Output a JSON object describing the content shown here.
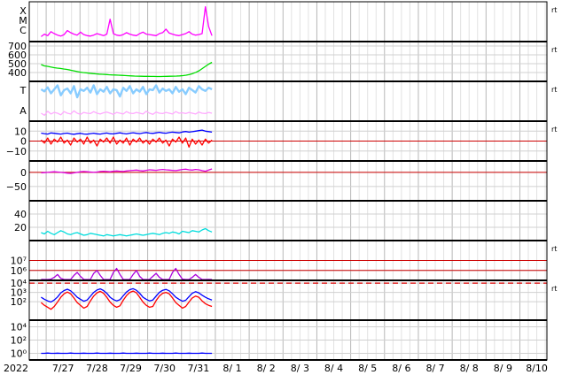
{
  "chart_data": {
    "type": "line",
    "x_axis": {
      "year_label": "2022",
      "tick_labels": [
        "7/27",
        "7/28",
        "7/29",
        "7/30",
        "7/31",
        "8/ 1",
        "8/ 2",
        "8/ 3",
        "8/ 4",
        "8/ 5",
        "8/ 6",
        "8/ 7",
        "8/ 8",
        "8/ 9",
        "8/10"
      ]
    },
    "panels": [
      {
        "id": "xray",
        "ylabel_letters": [
          "X",
          "M",
          "C"
        ],
        "yticks": [],
        "side_label": "rt",
        "series": [
          {
            "color": "#ff00ff",
            "values": [
              3,
              3.5,
              3.2,
              4,
              3.6,
              3.3,
              3.1,
              3.4,
              4.2,
              3.8,
              3.5,
              3.3,
              3.9,
              3.4,
              3.2,
              3.1,
              3.3,
              3.6,
              3.4,
              3.2,
              3.5,
              6.5,
              3.6,
              3.3,
              3.2,
              3.4,
              3.8,
              3.5,
              3.3,
              3.2,
              3.6,
              3.9,
              3.5,
              3.4,
              3.3,
              3.2,
              3.6,
              3.8,
              4.5,
              3.7,
              3.5,
              3.3,
              3.2,
              3.4,
              3.6,
              4,
              3.5,
              3.3,
              3.4,
              3.6,
              9,
              5,
              3.2
            ]
          }
        ]
      },
      {
        "id": "wind-speed",
        "yticks": [
          "700",
          "600",
          "500",
          "400"
        ],
        "side_label": "rt",
        "series": [
          {
            "color": "#00dd00",
            "values": [
              490,
              475,
              470,
              462,
              455,
              450,
              446,
              440,
              435,
              428,
              420,
              412,
              405,
              400,
              396,
              392,
              388,
              385,
              382,
              380,
              378,
              375,
              373,
              372,
              370,
              368,
              366,
              364,
              362,
              360,
              359,
              358,
              357,
              357,
              356,
              356,
              355,
              355,
              356,
              357,
              358,
              359,
              360,
              362,
              365,
              370,
              378,
              388,
              402,
              420,
              445,
              470,
              495,
              515
            ]
          }
        ]
      },
      {
        "id": "density",
        "ylabel_letters": [
          "T",
          "A"
        ],
        "yticks": [],
        "side_label": "rt",
        "series": [
          {
            "color": "#88ccff",
            "values": [
              0.8,
              0.75,
              0.85,
              0.7,
              0.8,
              0.9,
              0.65,
              0.78,
              0.82,
              0.7,
              0.88,
              0.6,
              0.8,
              0.76,
              0.84,
              0.72,
              0.9,
              0.68,
              0.8,
              0.74,
              0.86,
              0.7,
              0.8,
              0.78,
              0.62,
              0.84,
              0.76,
              0.88,
              0.7,
              0.8,
              0.74,
              0.86,
              0.68,
              0.8,
              0.78,
              0.9,
              0.72,
              0.82,
              0.76,
              0.8,
              0.7,
              0.86,
              0.74,
              0.8,
              0.68,
              0.84,
              0.78,
              0.72,
              0.88,
              0.8,
              0.76,
              0.84,
              0.8
            ]
          },
          {
            "color": "#ffaaff",
            "values": [
              0.2,
              0.15,
              0.25,
              0.18,
              0.22,
              0.2,
              0.16,
              0.24,
              0.2,
              0.18,
              0.26,
              0.2,
              0.17,
              0.22,
              0.2,
              0.19,
              0.24,
              0.2,
              0.18,
              0.21,
              0.23,
              0.2,
              0.17,
              0.22,
              0.2,
              0.18,
              0.24,
              0.2,
              0.19,
              0.22,
              0.2,
              0.18,
              0.25,
              0.2,
              0.17,
              0.23,
              0.2,
              0.19,
              0.22,
              0.2,
              0.18,
              0.24,
              0.2,
              0.21,
              0.19,
              0.22,
              0.2,
              0.18,
              0.23,
              0.2,
              0.19,
              0.22,
              0.2
            ]
          }
        ]
      },
      {
        "id": "imf",
        "yticks": [
          "10",
          "0",
          "−10"
        ],
        "side_label": "rt",
        "baseline": 0,
        "series": [
          {
            "color": "#0000ff",
            "values": [
              8,
              7.5,
              7,
              8.2,
              7.8,
              7.4,
              7,
              7.6,
              8,
              7.2,
              6.8,
              7.4,
              7.8,
              7.1,
              6.9,
              7.5,
              7.9,
              7.3,
              7,
              7.6,
              8.1,
              7.4,
              7.2,
              7.8,
              8.3,
              7.6,
              7.2,
              7.9,
              8.4,
              7.8,
              7.5,
              8.1,
              8.6,
              8,
              7.7,
              8.3,
              8.8,
              8.2,
              7.9,
              8.5,
              9,
              8.6,
              8.3,
              9.2,
              9.6,
              9,
              9.4,
              10,
              10.5,
              11,
              10,
              9.5,
              9
            ]
          },
          {
            "color": "#ff0000",
            "values": [
              1,
              -2,
              3,
              -3,
              2,
              -1,
              4,
              -2,
              1,
              -4,
              3,
              -1,
              2,
              -3,
              4,
              -2,
              1,
              -5,
              2,
              -1,
              3,
              -2,
              4,
              -3,
              1,
              -2,
              3,
              -4,
              2,
              -1,
              3,
              -2,
              1,
              -3,
              2,
              -1,
              3,
              -2,
              1,
              -5,
              2,
              -1,
              4,
              -2,
              3,
              -6,
              2,
              -3,
              1,
              -4,
              2,
              -2,
              1
            ]
          }
        ]
      },
      {
        "id": "dst",
        "yticks": [
          "0",
          "−50"
        ],
        "side_label": "",
        "baseline": 0,
        "series": [
          {
            "color": "#dd00dd",
            "values": [
              -2,
              -1,
              0,
              1,
              2,
              1,
              0,
              -1,
              -3,
              -4,
              -2,
              0,
              2,
              3,
              2,
              1,
              0,
              1,
              3,
              4,
              3,
              2,
              4,
              5,
              4,
              3,
              5,
              6,
              7,
              8,
              6,
              5,
              7,
              9,
              8,
              7,
              9,
              10,
              9,
              8,
              7,
              6,
              8,
              10,
              11,
              9,
              8,
              10,
              9,
              6,
              4,
              8,
              12
            ]
          }
        ]
      },
      {
        "id": "kp",
        "yticks": [
          "40",
          "20"
        ],
        "side_label": "",
        "series": [
          {
            "color": "#00dddd",
            "values": [
              12,
              10,
              14,
              11,
              9,
              12,
              15,
              13,
              10,
              9,
              11,
              12,
              10,
              8,
              9,
              11,
              10,
              9,
              8,
              7,
              9,
              8,
              7,
              8,
              9,
              8,
              7,
              8,
              9,
              10,
              9,
              8,
              9,
              10,
              11,
              10,
              9,
              11,
              12,
              11,
              13,
              12,
              10,
              14,
              13,
              12,
              15,
              14,
              13,
              16,
              18,
              15,
              13
            ]
          }
        ]
      },
      {
        "id": "electron",
        "yticks": [
          "10⁷",
          "10⁶"
        ],
        "side_label": "rt",
        "series": [
          {
            "color": "#aa00dd",
            "values": [
              0.5,
              0.3,
              0.4,
              0.6,
              1.5,
              3,
              1,
              0.4,
              0.3,
              0.5,
              2.5,
              4,
              2,
              0.5,
              0.3,
              0.4,
              3.5,
              5,
              2.5,
              0.4,
              0.3,
              0.5,
              4,
              6,
              3,
              0.5,
              0.3,
              0.4,
              3,
              5,
              2,
              0.4,
              0.3,
              0.5,
              2,
              3.5,
              1.5,
              0.4,
              0.3,
              0.5,
              4,
              6,
              3,
              0.6,
              0.4,
              0.3,
              1.5,
              3,
              1.5,
              0.4,
              0.3,
              0.5,
              0.4
            ]
          }
        ]
      },
      {
        "id": "proton",
        "yticks": [
          "10⁴",
          "10³",
          "10²"
        ],
        "side_label": "rt",
        "threshold": 10000,
        "series": [
          {
            "color": "#0000ff",
            "values": [
              300,
              180,
              120,
              90,
              150,
              320,
              900,
              1600,
              2200,
              1500,
              700,
              300,
              180,
              110,
              150,
              380,
              1000,
              1800,
              2400,
              1600,
              800,
              300,
              170,
              120,
              160,
              420,
              1100,
              2000,
              2500,
              1700,
              800,
              300,
              180,
              120,
              150,
              400,
              1000,
              1700,
              2100,
              1500,
              700,
              300,
              180,
              110,
              140,
              350,
              800,
              1200,
              900,
              500,
              300,
              200,
              150
            ]
          },
          {
            "color": "#ff0000",
            "values": [
              80,
              40,
              25,
              15,
              30,
              90,
              300,
              700,
              1100,
              700,
              250,
              80,
              40,
              20,
              30,
              120,
              400,
              900,
              1300,
              800,
              300,
              90,
              40,
              25,
              35,
              140,
              450,
              1000,
              1400,
              900,
              300,
              90,
              40,
              25,
              30,
              130,
              400,
              800,
              1000,
              700,
              250,
              80,
              40,
              20,
              30,
              90,
              250,
              400,
              300,
              120,
              60,
              40,
              30
            ]
          }
        ]
      },
      {
        "id": "proton-low",
        "yticks": [
          "10⁴",
          "10²",
          "10⁰"
        ],
        "side_label": "",
        "series": [
          {
            "color": "#0000ff",
            "values": [
              1,
              1,
              1.1,
              1,
              1,
              1.05,
              1,
              1,
              1,
              1.1,
              1,
              1,
              1,
              1.05,
              1,
              1,
              1,
              1.1,
              1,
              1,
              1,
              1.05,
              1,
              1,
              1,
              1.1,
              1,
              1,
              1,
              1.05,
              1,
              1,
              1,
              1.1,
              1,
              1,
              1,
              1.05,
              1,
              1,
              1,
              1.1,
              1,
              1,
              1,
              1.05,
              1,
              1,
              1,
              1.1,
              1,
              1,
              1
            ]
          }
        ]
      }
    ]
  }
}
